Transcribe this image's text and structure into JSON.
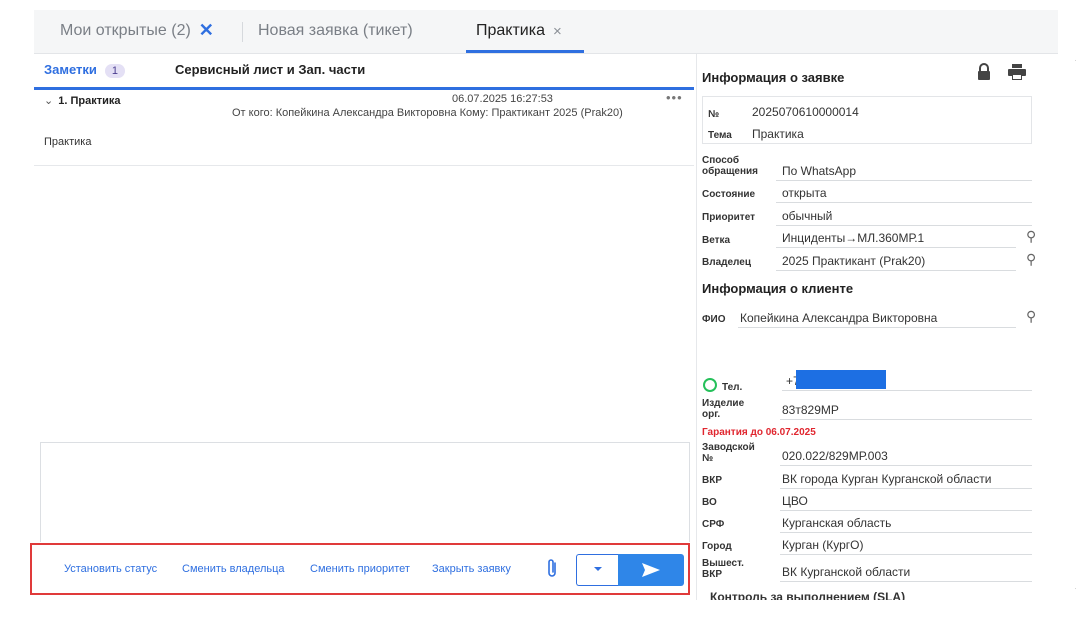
{
  "tabs": [
    {
      "label": "Мои открытые (2)",
      "close": "✕"
    },
    {
      "label": "Новая заявка (тикет)"
    },
    {
      "label": "Практика",
      "close": "×"
    }
  ],
  "subtabs": {
    "notes": "Заметки",
    "notes_count": "1",
    "service": "Сервисный лист и Зап. части"
  },
  "note": {
    "title": "1. Практика",
    "datetime": "06.07.2025 16:27:53",
    "more": "•••",
    "from_to": "От кого: Копейкина Александра Викторовна  Кому: Практикант 2025 (Prak20)",
    "body": "Практика"
  },
  "actions": {
    "set_status": "Установить статус",
    "change_owner": "Сменить владельца",
    "change_priority": "Сменить приоритет",
    "close_ticket": "Закрыть заявку"
  },
  "ticket_info": {
    "title": "Информация о заявке",
    "number_label": "№",
    "number": "2025070610000014",
    "topic_label": "Тема",
    "topic": "Практика",
    "method_label": "Способ обращения",
    "method": "По WhatsApp",
    "state_label": "Состояние",
    "state": "открыта",
    "priority_label": "Приоритет",
    "priority": "обычный",
    "branch_label": "Ветка",
    "branch": "Инциденты→МЛ.360МР.1",
    "owner_label": "Владелец",
    "owner": "2025 Практикант (Prak20)"
  },
  "client_info": {
    "title": "Информация о клиенте",
    "fio_label": "ФИО",
    "fio": "Копейкина Александра Викторовна",
    "phone_label": "Тел.",
    "phone": "+7",
    "product_label": "Изделие орг.",
    "product": "83т829МР",
    "warranty": "Гарантия до 06.07.2025",
    "serial_label": "Заводской №",
    "serial": "020.022/829МР.003",
    "vkr_label": "ВКР",
    "vkr": "ВК города Курган Курганской области",
    "vo_label": "ВО",
    "vo": "ЦВО",
    "srf_label": "СРФ",
    "srf": "Курганская область",
    "city_label": "Город",
    "city": "Курган (КургО)",
    "higher_label": "Вышест. ВКР",
    "higher": "ВК Курганской области",
    "sla": "Контроль за выполнением (SLA)"
  },
  "colors": {
    "accent": "#2f6fe0",
    "send": "#2f86e8",
    "warning": "#e0262f",
    "highlight_border": "#e03a3a"
  }
}
